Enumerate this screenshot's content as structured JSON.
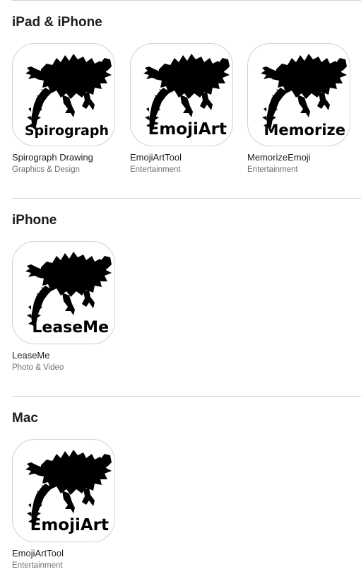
{
  "sections": [
    {
      "title": "iPad & iPhone",
      "apps": [
        {
          "icon_text": "Spirograph",
          "name": "Spirograph Drawing",
          "category": "Graphics & Design",
          "icon": "lizard-silhouette-icon"
        },
        {
          "icon_text": "EmojiArt",
          "name": "EmojiArtTool",
          "category": "Entertainment",
          "icon": "lizard-silhouette-icon"
        },
        {
          "icon_text": "Memorize",
          "name": "MemorizeEmoji",
          "category": "Entertainment",
          "icon": "lizard-silhouette-icon"
        }
      ]
    },
    {
      "title": "iPhone",
      "apps": [
        {
          "icon_text": "LeaseMe",
          "name": "LeaseMe",
          "category": "Photo & Video",
          "icon": "lizard-silhouette-icon"
        }
      ]
    },
    {
      "title": "Mac",
      "apps": [
        {
          "icon_text": "EmojiArt",
          "name": "EmojiArtTool",
          "category": "Entertainment",
          "icon": "lizard-silhouette-icon"
        }
      ]
    }
  ],
  "colors": {
    "divider": "#d2d2d7",
    "title_text": "#1d1d1f",
    "category_text": "#6e6e73",
    "icon_silhouette": "#000000"
  }
}
